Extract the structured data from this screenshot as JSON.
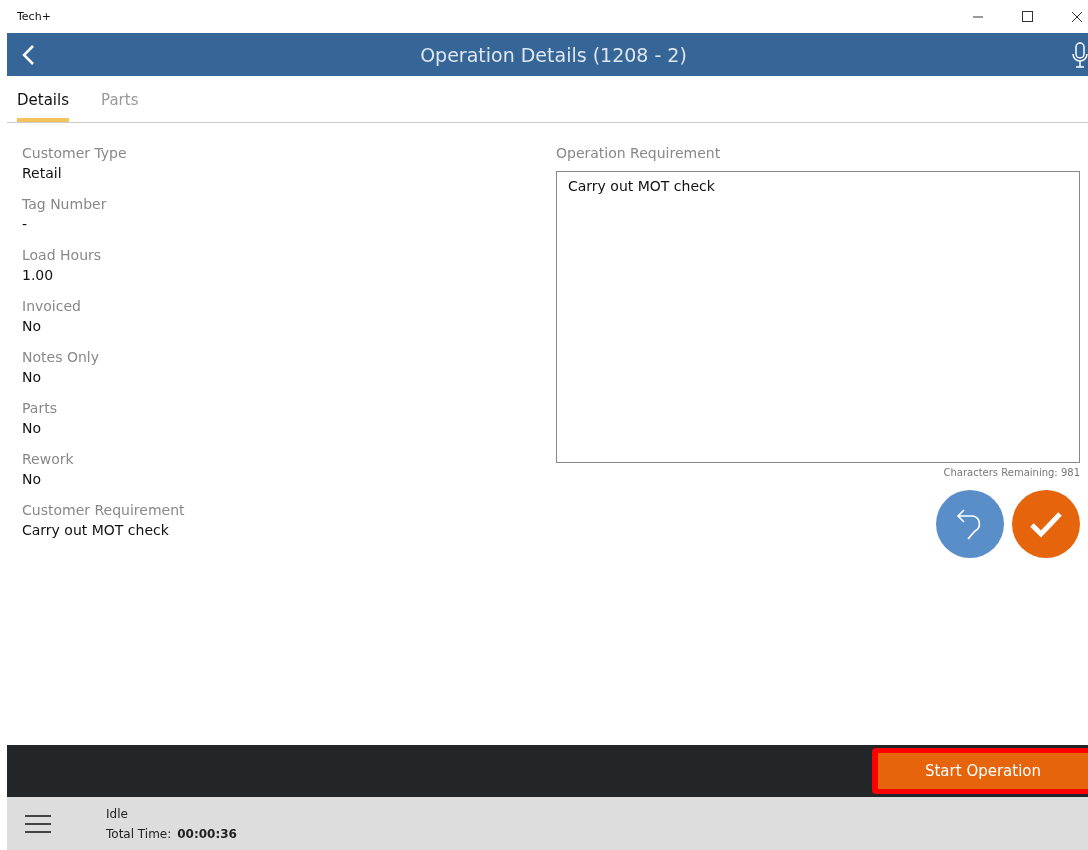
{
  "window": {
    "title": "Tech+"
  },
  "header": {
    "title": "Operation Details (1208 - 2)"
  },
  "tabs": [
    {
      "label": "Details",
      "selected": true
    },
    {
      "label": "Parts",
      "selected": false
    }
  ],
  "fields": [
    {
      "label": "Customer Type",
      "value": "Retail"
    },
    {
      "label": "Tag Number",
      "value": "-"
    },
    {
      "label": "Load Hours",
      "value": "1.00"
    },
    {
      "label": "Invoiced",
      "value": "No"
    },
    {
      "label": "Notes Only",
      "value": "No"
    },
    {
      "label": "Parts",
      "value": "No"
    },
    {
      "label": "Rework",
      "value": "No"
    },
    {
      "label": "Customer Requirement",
      "value": "Carry out MOT check"
    }
  ],
  "operation_requirement": {
    "label": "Operation Requirement",
    "value": "Carry out MOT check",
    "characters_remaining": "Characters Remaining: 981"
  },
  "action_bar": {
    "button": "Start Operation",
    "highlighted": true
  },
  "status_bar": {
    "status": "Idle",
    "total_time_label": "Total Time:",
    "total_time": "00:00:36"
  }
}
